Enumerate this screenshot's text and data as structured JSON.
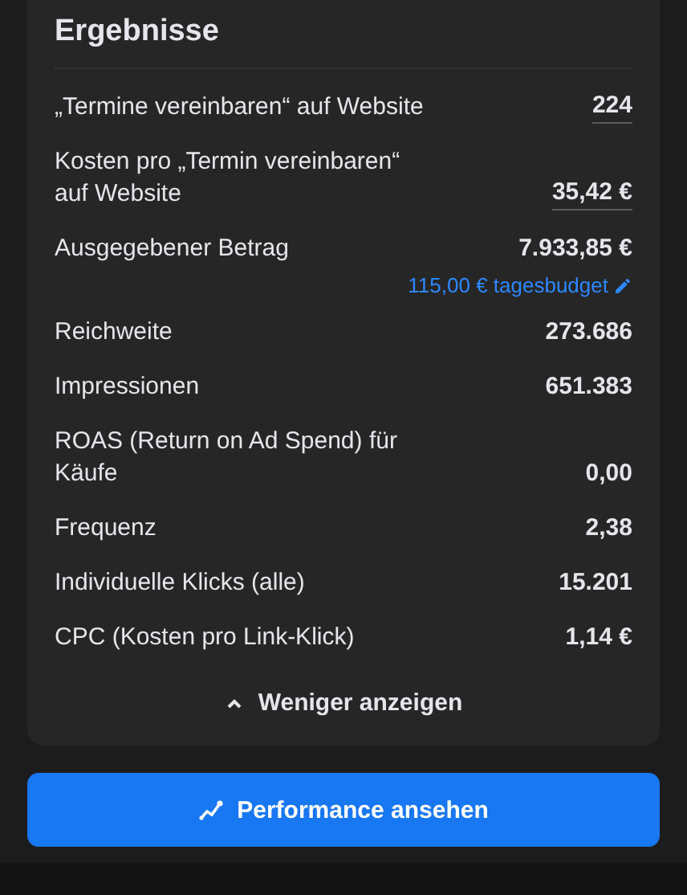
{
  "title": "Ergebnisse",
  "rows": [
    {
      "label": "„Termine vereinbaren“ auf Website",
      "value": "224",
      "underlined": true
    },
    {
      "label": "Kosten pro „Termin vereinbaren“ auf Website",
      "value": "35,42 €",
      "underlined": true
    },
    {
      "label": "Ausgegebener Betrag",
      "value": "7.933,85 €",
      "underlined": false,
      "link": "115,00 € tagesbudget"
    },
    {
      "label": "Reichweite",
      "value": "273.686",
      "underlined": false
    },
    {
      "label": "Impressionen",
      "value": "651.383",
      "underlined": false
    },
    {
      "label": "ROAS (Return on Ad Spend) für Käufe",
      "value": "0,00",
      "underlined": false
    },
    {
      "label": "Frequenz",
      "value": "2,38",
      "underlined": false
    },
    {
      "label": "Individuelle Klicks (alle)",
      "value": "15.201",
      "underlined": false
    },
    {
      "label": "CPC (Kosten pro Link-Klick)",
      "value": "1,14 €",
      "underlined": false
    }
  ],
  "toggle": {
    "label": "Weniger anzeigen",
    "expanded": true
  },
  "button": {
    "label": "Performance ansehen"
  }
}
